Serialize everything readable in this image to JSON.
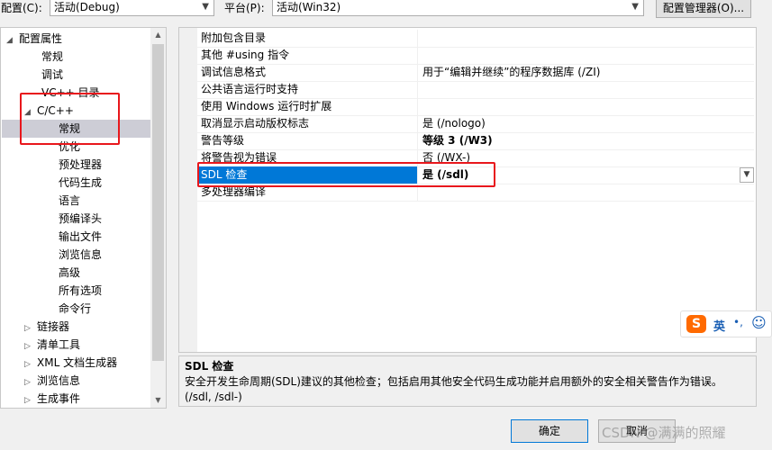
{
  "config_bar": {
    "config_label": "配置(C):",
    "config_value": "活动(Debug)",
    "platform_label": "平台(P):",
    "platform_value": "活动(Win32)",
    "manager_button": "配置管理器(O)..."
  },
  "tree": {
    "items": [
      {
        "label": "配置属性",
        "expander": "◢"
      },
      {
        "label": "常规"
      },
      {
        "label": "调试"
      },
      {
        "label": "VC++ 目录"
      },
      {
        "label": "C/C++",
        "expander": "◢"
      },
      {
        "label": "常规",
        "selected": true
      },
      {
        "label": "优化"
      },
      {
        "label": "预处理器"
      },
      {
        "label": "代码生成"
      },
      {
        "label": "语言"
      },
      {
        "label": "预编译头"
      },
      {
        "label": "输出文件"
      },
      {
        "label": "浏览信息"
      },
      {
        "label": "高级"
      },
      {
        "label": "所有选项"
      },
      {
        "label": "命令行"
      },
      {
        "label": "链接器",
        "expander": "▷"
      },
      {
        "label": "清单工具",
        "expander": "▷"
      },
      {
        "label": "XML 文档生成器",
        "expander": "▷"
      },
      {
        "label": "浏览信息",
        "expander": "▷"
      },
      {
        "label": "生成事件",
        "expander": "▷"
      }
    ]
  },
  "grid": {
    "rows": [
      {
        "name": "附加包含目录",
        "value": ""
      },
      {
        "name": "其他 #using 指令",
        "value": ""
      },
      {
        "name": "调试信息格式",
        "value": "用于“编辑并继续”的程序数据库 (/ZI)"
      },
      {
        "name": "公共语言运行时支持",
        "value": ""
      },
      {
        "name": "使用 Windows 运行时扩展",
        "value": ""
      },
      {
        "name": "取消显示启动版权标志",
        "value": "是 (/nologo)"
      },
      {
        "name": "警告等级",
        "value": "等级 3 (/W3)",
        "bold": true
      },
      {
        "name": "将警告视为错误",
        "value": "否 (/WX-)"
      },
      {
        "name": "SDL 检查",
        "value": "是 (/sdl)",
        "selected": true
      },
      {
        "name": "多处理器编译",
        "value": ""
      }
    ]
  },
  "description": {
    "title": "SDL 检查",
    "body": "安全开发生命周期(SDL)建议的其他检查；包括启用其他安全代码生成功能并启用额外的安全相关警告作为错误。",
    "switches": "(/sdl, /sdl-)"
  },
  "buttons": {
    "ok": "确定",
    "cancel": "取消"
  },
  "ime": {
    "logo": "S",
    "mode": "英",
    "punct": "•,",
    "emoji": "☺"
  },
  "watermark": "CSDN @满满的照耀"
}
